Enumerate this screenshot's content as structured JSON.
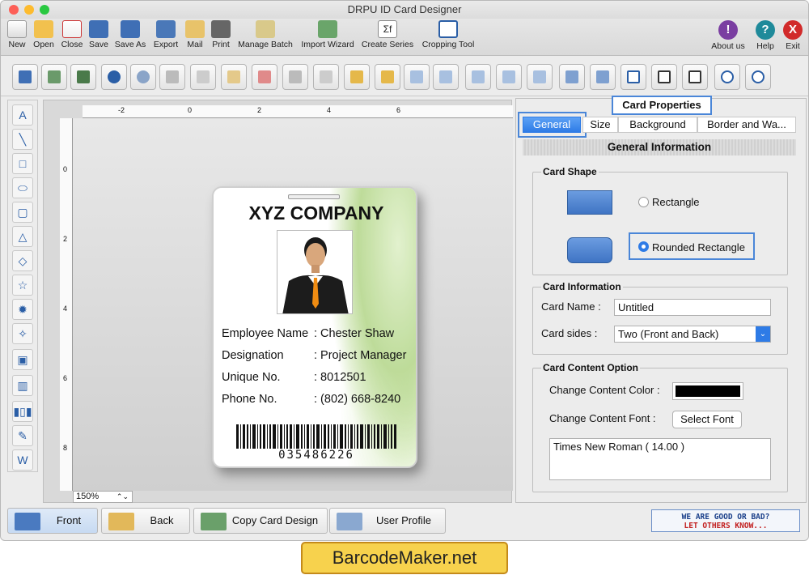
{
  "window": {
    "title": "DRPU ID Card Designer"
  },
  "toolbar": {
    "items": [
      "New",
      "Open",
      "Close",
      "Save",
      "Save As",
      "Export",
      "Mail",
      "Print",
      "Manage Batch",
      "Import Wizard",
      "Create Series",
      "Cropping Tool"
    ],
    "right": [
      "About us",
      "Help",
      "Exit"
    ]
  },
  "canvas": {
    "zoom": "150%",
    "ruler_top": [
      "-2",
      "0",
      "2",
      "4",
      "6"
    ],
    "ruler_left": [
      "0",
      "2",
      "4",
      "6",
      "8"
    ]
  },
  "card": {
    "company": "XYZ COMPANY",
    "fields": [
      {
        "label": "Employee Name",
        "value": ": Chester Shaw"
      },
      {
        "label": "Designation",
        "value": ": Project Manager"
      },
      {
        "label": "Unique No.",
        "value": ": 8012501"
      },
      {
        "label": "Phone No.",
        "value": ": (802) 668-8240"
      }
    ],
    "barcode_number": "035486226"
  },
  "panel": {
    "title": "Card Properties",
    "tabs": [
      "General",
      "Size",
      "Background",
      "Border and Wa..."
    ],
    "active_tab": "General",
    "section_header": "General Information",
    "card_shape": {
      "title": "Card Shape",
      "options": [
        "Rectangle",
        "Rounded Rectangle"
      ],
      "selected": "Rounded Rectangle"
    },
    "card_info": {
      "title": "Card Information",
      "name_label": "Card Name :",
      "name_value": "Untitled",
      "sides_label": "Card sides :",
      "sides_value": "Two (Front and Back)"
    },
    "content": {
      "title": "Card Content Option",
      "color_label": "Change Content Color :",
      "content_color": "#000000",
      "font_label": "Change Content Font :",
      "font_button": "Select Font",
      "font_value": "Times New Roman ( 14.00 )"
    }
  },
  "bottom": {
    "buttons": [
      "Front",
      "Back",
      "Copy Card Design",
      "User Profile"
    ],
    "feedback_line1": "WE ARE GOOD OR BAD?",
    "feedback_line2": "LET OTHERS KNOW..."
  },
  "brand": "BarcodeMaker.net",
  "colors": {
    "accent": "#2e7be6",
    "highlight": "#4a86d8",
    "brand_bg": "#f7d24d"
  }
}
